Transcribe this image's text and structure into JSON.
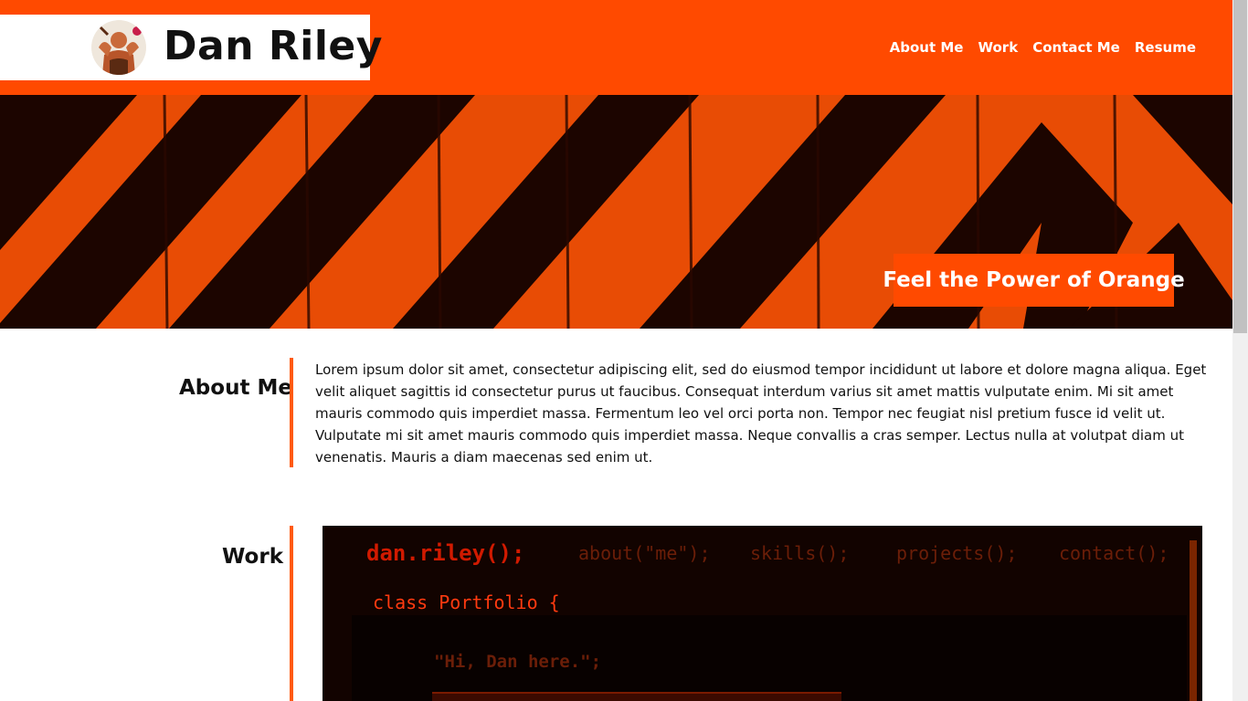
{
  "header": {
    "site_title": "Dan Riley",
    "nav": [
      "About Me",
      "Work",
      "Contact Me",
      "Resume"
    ]
  },
  "hero": {
    "tagline": "Feel the Power of Orange"
  },
  "about": {
    "title": "About Me",
    "text": "Lorem ipsum dolor sit amet, consectetur adipiscing elit, sed do eiusmod tempor incididunt ut labore et dolore magna aliqua. Eget velit aliquet sagittis id consectetur purus ut faucibus. Consequat interdum varius sit amet mattis vulputate enim. Mi sit amet mauris commodo quis imperdiet massa. Fermentum leo vel orci porta non. Tempor nec feugiat nisl pretium fusce id velit ut. Vulputate mi sit amet mauris commodo quis imperdiet massa. Neque convallis a cras semper. Lectus nulla at volutpat diam ut venenatis. Mauris a diam maecenas sed enim ut."
  },
  "work": {
    "title": "Work",
    "panel": {
      "brand": "dan.riley();",
      "links": [
        "about(\"me\");",
        "skills();",
        "projects();",
        "contact();"
      ],
      "class_line": "class Portfolio {",
      "greeting": "\"Hi, Dan here.\";"
    }
  },
  "colors": {
    "accent": "#ff4a00",
    "dark_stripe": "#1a0500",
    "panel_bg": "#120300"
  }
}
